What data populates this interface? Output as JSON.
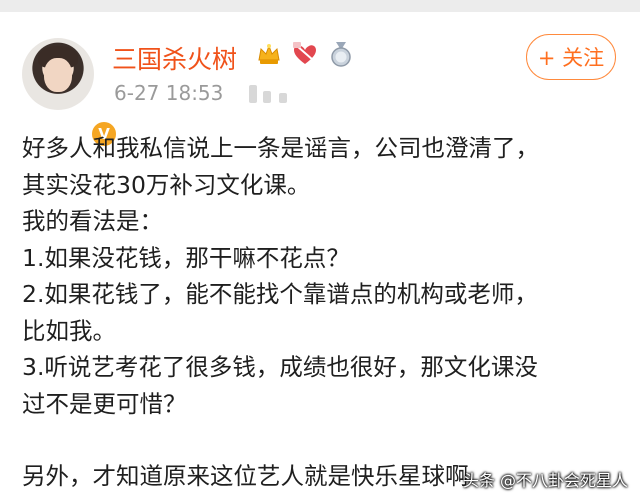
{
  "user": {
    "name": "三国杀火树",
    "verified_badge": "V",
    "badges": [
      "crown-badge",
      "heart-badge",
      "medal-badge"
    ]
  },
  "post": {
    "timestamp": "6-27 18:53",
    "lines": [
      "好多人和我私信说上一条是谣言，公司也澄清了，",
      "其实没花30万补习文化课。",
      "我的看法是：",
      "1.如果没花钱，那干嘛不花点？",
      "2.如果花钱了，能不能找个靠谱点的机构或老师，",
      "比如我。",
      "3.听说艺考花了很多钱，成绩也很好，那文化课没",
      "过不是更可惜？",
      "另外，才知道原来这位艺人就是快乐星球啊"
    ]
  },
  "actions": {
    "follow_label": "+ 关注"
  },
  "watermark": "头条 @不八卦会死星人",
  "colors": {
    "username": "#f0521a",
    "follow_border": "#ff8a3d",
    "meta": "#9a9a9a"
  }
}
